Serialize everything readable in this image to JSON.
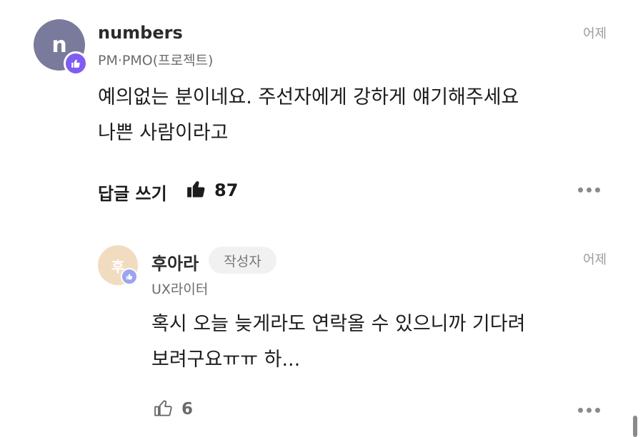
{
  "comment": {
    "avatar_letter": "n",
    "author": "numbers",
    "role": "PM·PMO(프로젝트)",
    "time": "어제",
    "body_line1": "예의없는 분이네요. 주선자에게 강하게 얘기해주세요",
    "body_line2": "나쁜 사람이라고",
    "reply_label": "답글 쓰기",
    "like_count": "87"
  },
  "reply": {
    "avatar_letter": "후",
    "author": "후아라",
    "author_badge": "작성자",
    "role": "UX라이터",
    "time": "어제",
    "body_line1": "혹시 오늘 늦게라도 연락올 수 있으니까 기다려",
    "body_line2": "보려구요ㅠㅠ 하...",
    "like_count": "6"
  },
  "colors": {
    "avatar_main": "#7a7a9c",
    "avatar_reply": "#f2dcc0",
    "badge": "#7f5cf2"
  }
}
